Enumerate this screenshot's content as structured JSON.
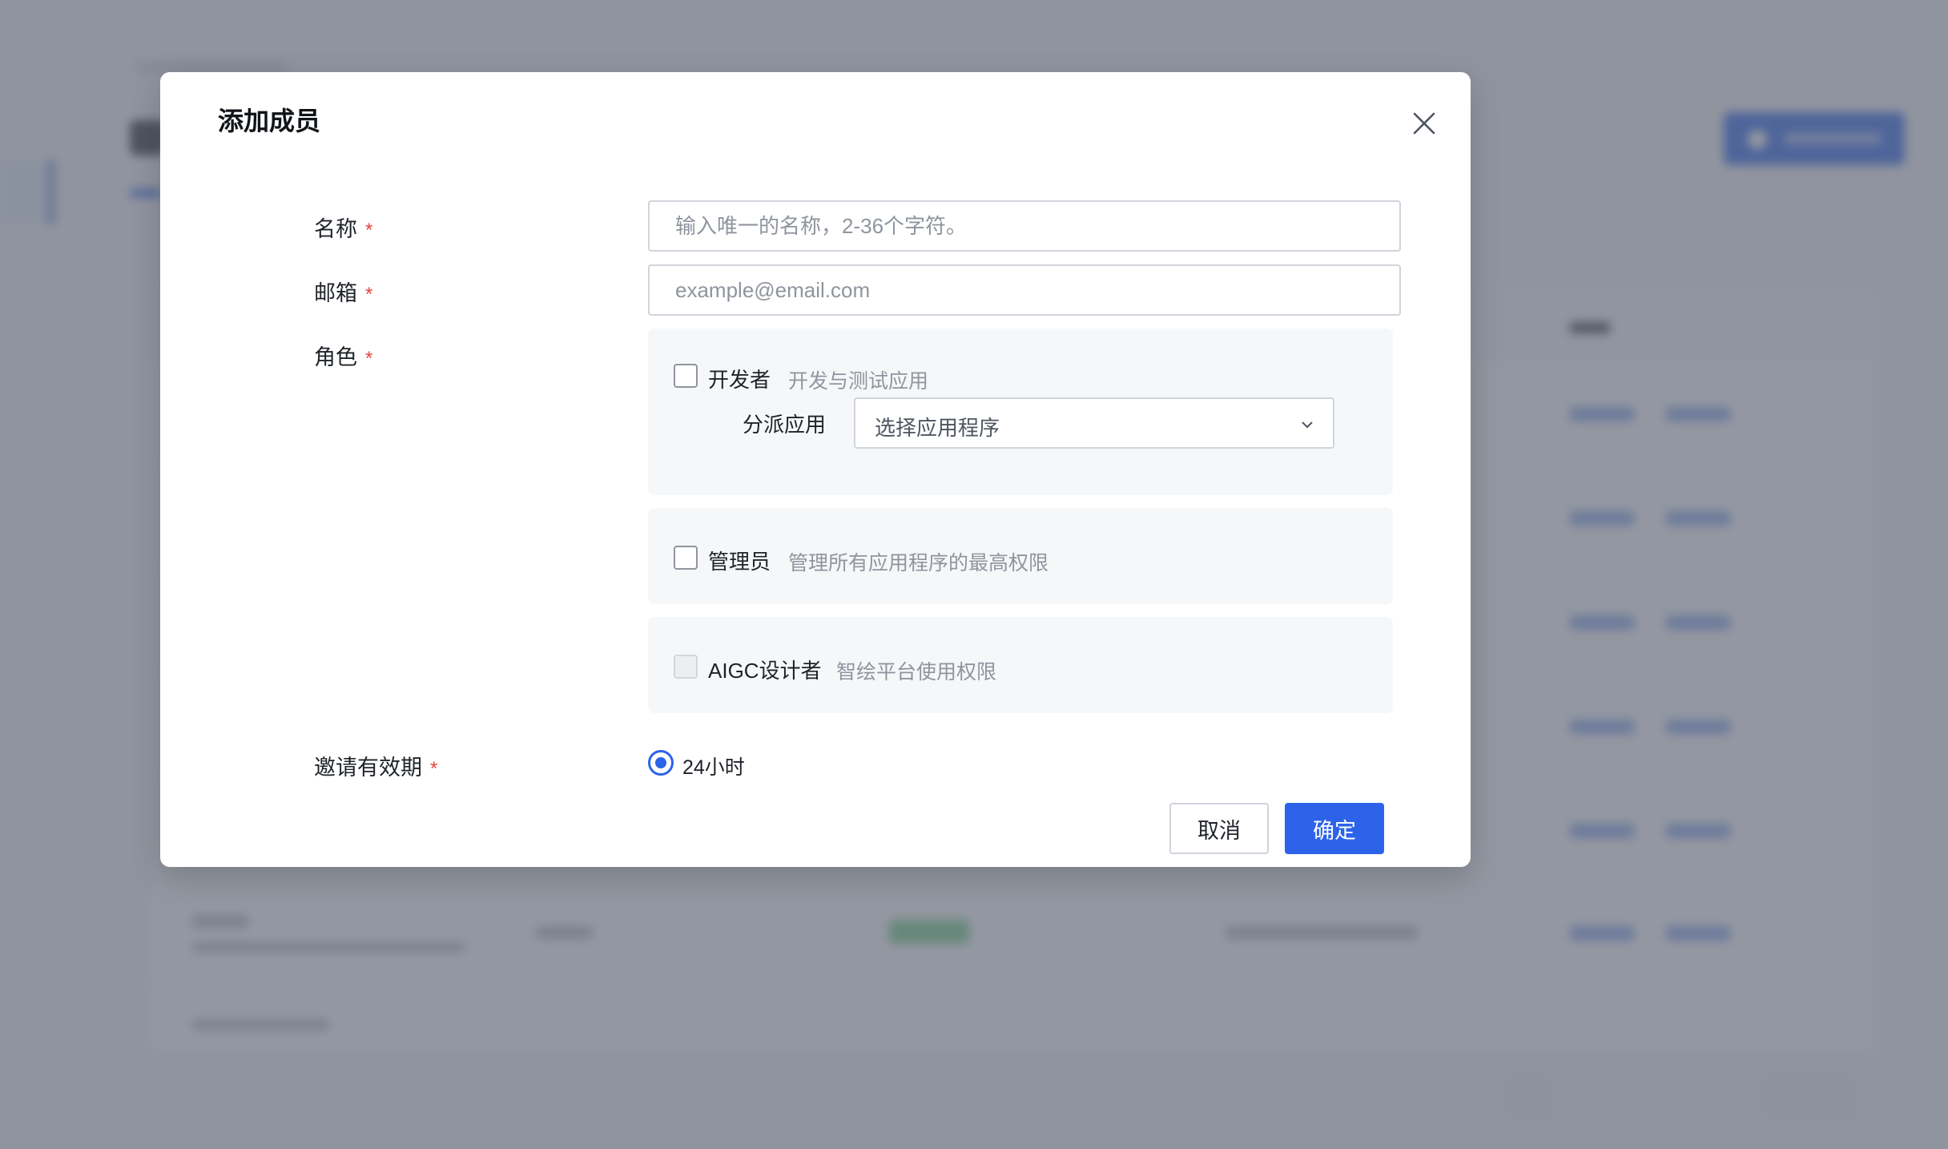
{
  "modal": {
    "title": "添加成员",
    "close_icon": "close-icon"
  },
  "form": {
    "name": {
      "label": "名称",
      "required_mark": "*",
      "placeholder": "输入唯一的名称，2-36个字符。",
      "value": ""
    },
    "email": {
      "label": "邮箱",
      "required_mark": "*",
      "placeholder": "example@email.com",
      "value": ""
    },
    "role": {
      "label": "角色",
      "required_mark": "*",
      "options": [
        {
          "name": "开发者",
          "desc": "开发与测试应用",
          "checked": false,
          "disabled": false
        },
        {
          "name": "管理员",
          "desc": "管理所有应用程序的最高权限",
          "checked": false,
          "disabled": false
        },
        {
          "name": "AIGC设计者",
          "desc": "智绘平台使用权限",
          "checked": false,
          "disabled": true
        }
      ],
      "assign_label": "分派应用",
      "assign_placeholder": "选择应用程序",
      "assign_icon": "chevron-down-icon"
    },
    "expiry": {
      "label": "邀请有效期",
      "required_mark": "*",
      "option": "24小时",
      "selected": true
    }
  },
  "actions": {
    "cancel": "取消",
    "ok": "确定"
  },
  "colors": {
    "primary": "#2d63ea",
    "required": "#e5463b",
    "overlay": "rgba(96,102,116,0.68)"
  }
}
